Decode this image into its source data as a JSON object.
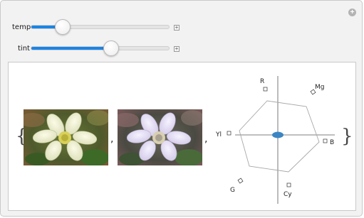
{
  "controls": {
    "temp": {
      "label": "temp",
      "value": 0.23
    },
    "tint": {
      "label": "tint",
      "value": 0.58
    }
  },
  "plot_labels": {
    "R": "R",
    "Mg": "Mg",
    "Yl": "Yl",
    "B": "B",
    "G": "G",
    "Cy": "Cy"
  },
  "colors": {
    "accent": "#1a84e6",
    "marker": "#3b86c2"
  }
}
